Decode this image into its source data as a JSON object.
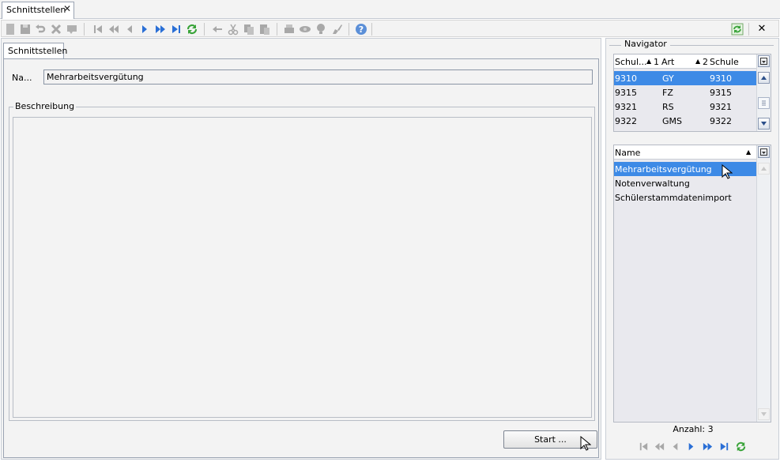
{
  "doc_tab": {
    "label": "Schnittstellen"
  },
  "form": {
    "tab_label": "Schnittstellen",
    "name_label": "Na...",
    "name_value": "Mehrarbeitsvergütung",
    "description_label": "Beschreibung",
    "description_value": "",
    "start_label": "Start ..."
  },
  "navigator": {
    "title": "Navigator",
    "columns": [
      {
        "label": "Schul...",
        "sort": "1"
      },
      {
        "label": "Art",
        "sort": "2"
      },
      {
        "label": "Schule",
        "sort": ""
      }
    ],
    "rows": [
      {
        "c1": "9310",
        "c2": "GY",
        "c3": "9310",
        "selected": true
      },
      {
        "c1": "9315",
        "c2": "FZ",
        "c3": "9315",
        "selected": false
      },
      {
        "c1": "9321",
        "c2": "RS",
        "c3": "9321",
        "selected": false
      },
      {
        "c1": "9322",
        "c2": "GMS",
        "c3": "9322",
        "selected": false
      }
    ]
  },
  "names_list": {
    "header": "Name",
    "items": [
      {
        "label": "Mehrarbeitsvergütung",
        "selected": true
      },
      {
        "label": "Notenverwaltung",
        "selected": false
      },
      {
        "label": "Schülerstammdatenimport",
        "selected": false
      }
    ]
  },
  "count_label": "Anzahl: 3",
  "colors": {
    "selection": "#3d8ae6",
    "nav_blue": "#2a6fd6",
    "refresh_green": "#3aa43a"
  }
}
